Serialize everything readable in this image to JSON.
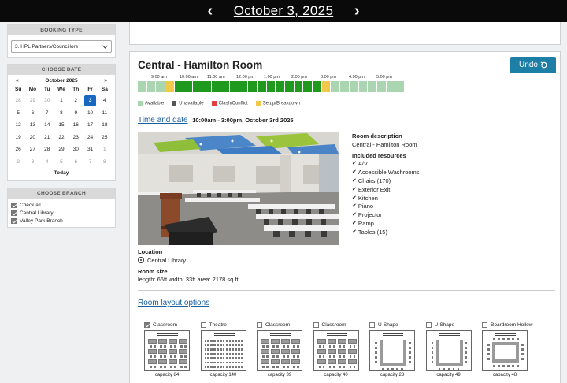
{
  "date_bar": {
    "prev": "‹",
    "next": "›",
    "date": "October 3, 2025"
  },
  "booking_type": {
    "header": "BOOKING TYPE",
    "selected": "3. HPL Partners/Councillors"
  },
  "calendar": {
    "header": "CHOOSE DATE",
    "month": "October 2025",
    "prev": "«",
    "next": "»",
    "dow": [
      "Su",
      "Mo",
      "Tu",
      "We",
      "Th",
      "Fr",
      "Sa"
    ],
    "weeks": [
      [
        "28",
        "29",
        "30",
        "1",
        "2",
        "3",
        "4"
      ],
      [
        "5",
        "6",
        "7",
        "8",
        "9",
        "10",
        "11"
      ],
      [
        "12",
        "13",
        "14",
        "15",
        "16",
        "17",
        "18"
      ],
      [
        "19",
        "20",
        "21",
        "22",
        "23",
        "24",
        "25"
      ],
      [
        "26",
        "27",
        "28",
        "29",
        "30",
        "31",
        "1"
      ],
      [
        "2",
        "3",
        "4",
        "5",
        "6",
        "7",
        "8"
      ]
    ],
    "today": "Today"
  },
  "branch": {
    "header": "CHOOSE BRANCH",
    "items": [
      {
        "label": "Check all",
        "checked": true
      },
      {
        "label": "Central Library",
        "checked": true
      },
      {
        "label": "Valley Park Branch",
        "checked": true
      }
    ]
  },
  "room": {
    "title": "Central - Hamilton Room",
    "undo": "Undo",
    "time_labels": [
      "9:00 am",
      "10:00 am",
      "11:00 am",
      "12:00 pm",
      "1:00 pm",
      "2:00 pm",
      "3:00 pm",
      "4:00 pm",
      "5:00 pm"
    ],
    "legend": [
      "Available",
      "Unavailable",
      "Clash/Conflict",
      "Setup/Breakdown"
    ],
    "legend_colors": [
      "#a9d6b1",
      "#555555",
      "#e04040",
      "#f1c94a"
    ],
    "time_and_date_label": "Time and date",
    "time_and_date_value": "10:00am - 3:00pm, October 3rd 2025",
    "description_label": "Room description",
    "description": "Central - Hamilton Room",
    "resources_label": "Included resources",
    "resources": [
      "A/V",
      "Accessible Washrooms",
      "Chairs (170)",
      "Exterior Exit",
      "Kitchen",
      "Piano",
      "Projector",
      "Ramp",
      "Tables (15)"
    ],
    "location_label": "Location",
    "location": "Central Library",
    "size_label": "Room size",
    "size": "length: 66ft  width: 33ft  area: 2178 sq ft",
    "layout_title": "Room layout options"
  },
  "layouts": [
    {
      "name": "Classroom",
      "checked": true,
      "capacity": "capacity 84",
      "kind": "classroom"
    },
    {
      "name": "Theatre",
      "checked": false,
      "capacity": "capacity 140",
      "kind": "theatre"
    },
    {
      "name": "Classroom",
      "checked": false,
      "capacity": "capacity 39",
      "kind": "classroom"
    },
    {
      "name": "Classroom",
      "checked": false,
      "capacity": "capacity 40",
      "kind": "classroom"
    },
    {
      "name": "U-Shape",
      "checked": false,
      "capacity": "capacity 23",
      "kind": "ushape"
    },
    {
      "name": "U-Shape",
      "checked": false,
      "capacity": "capacity 49",
      "kind": "ushape"
    },
    {
      "name": "Boardroom Hollow",
      "checked": false,
      "capacity": "capacity 48",
      "kind": "boardroom"
    }
  ]
}
